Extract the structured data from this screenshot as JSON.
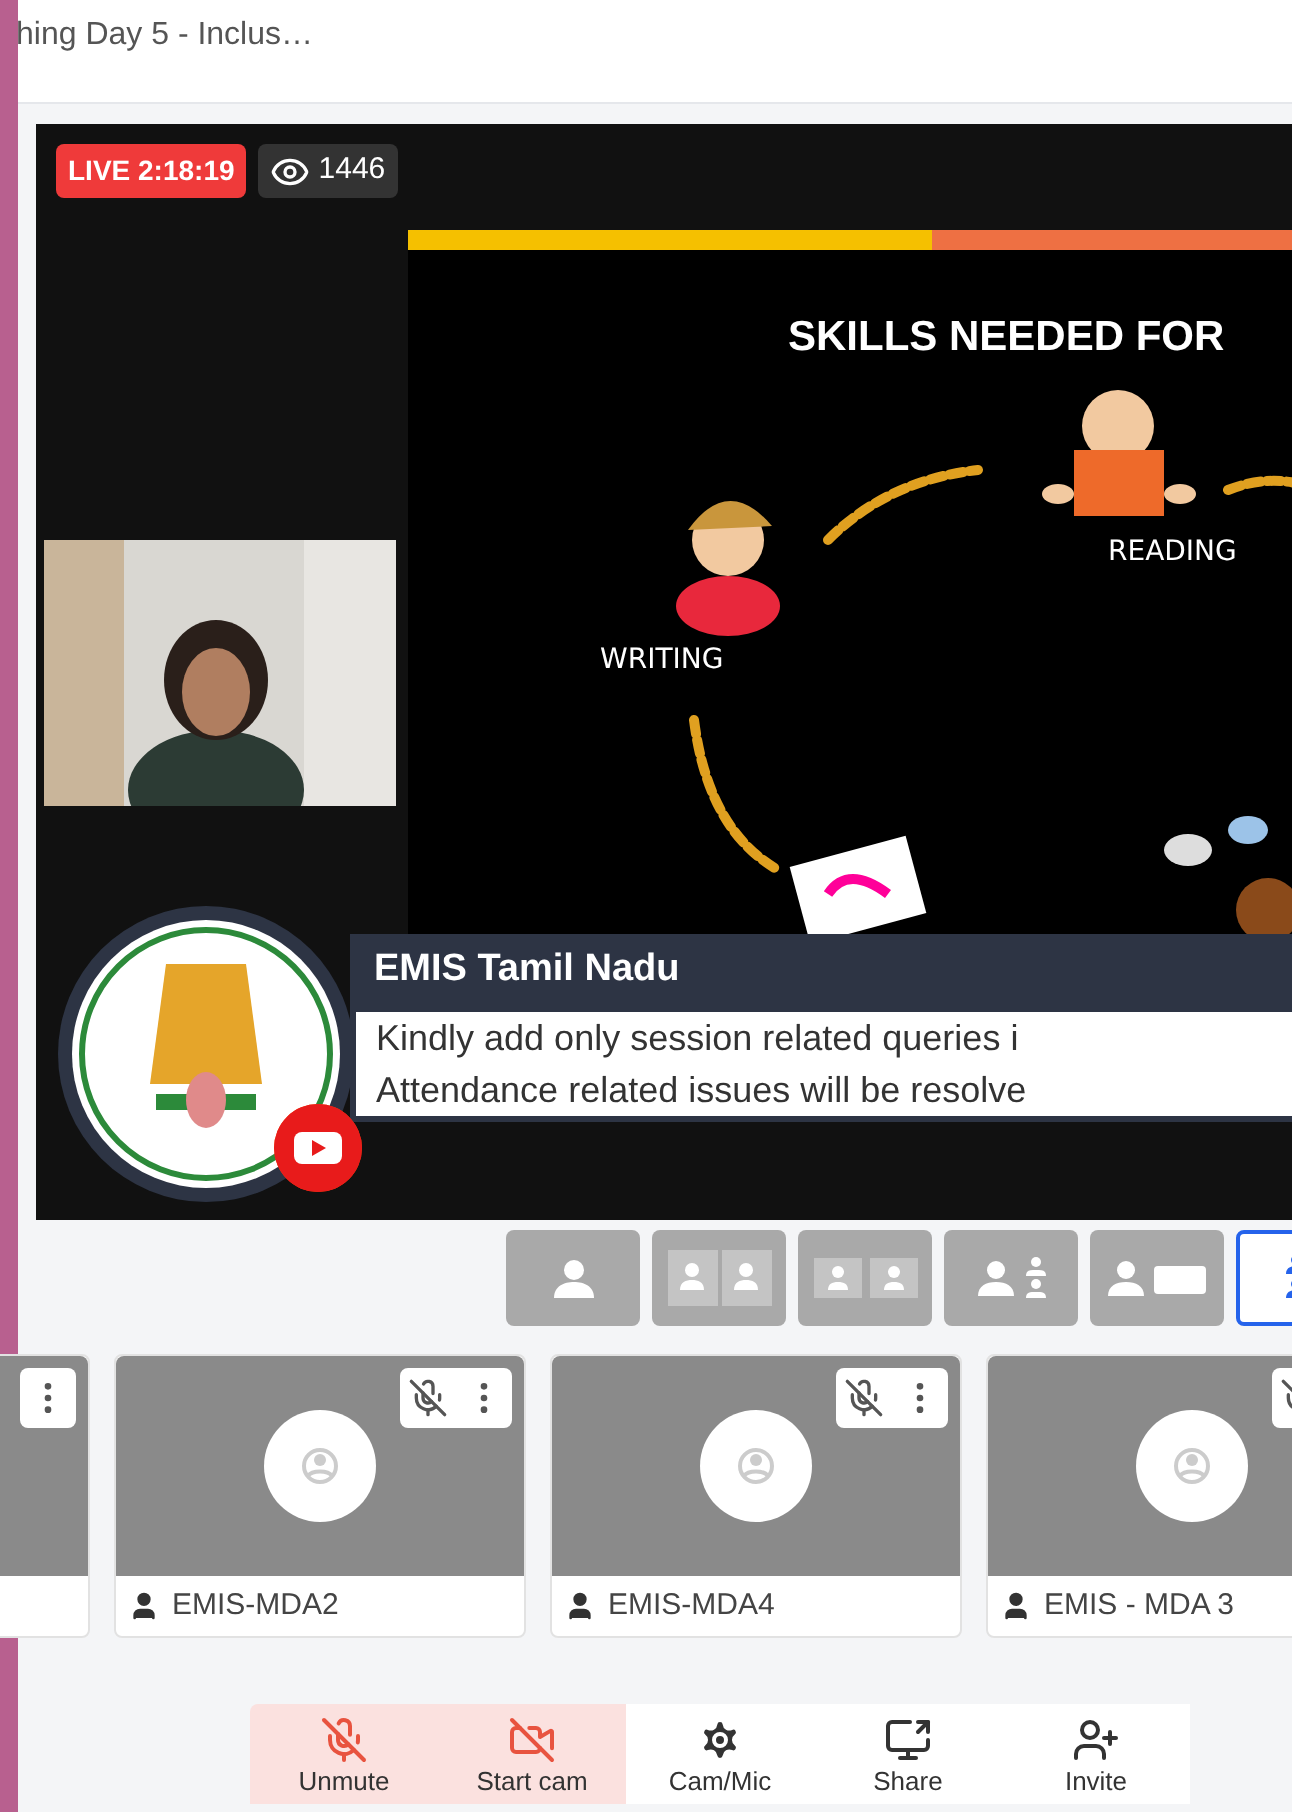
{
  "window": {
    "title": "hing Day 5 - Inclus…"
  },
  "stream": {
    "live_label": "LIVE 2:18:19",
    "viewers": "1446"
  },
  "slide": {
    "title": "SKILLS NEEDED FOR",
    "labels": [
      "WRITING",
      "READING"
    ]
  },
  "banner": {
    "title": "EMIS Tamil Nadu",
    "lines": [
      "Kindly add only session related queries i",
      "Attendance related issues will be resolve"
    ]
  },
  "layouts": [
    {
      "kind": "single",
      "selected": false
    },
    {
      "kind": "split",
      "selected": false
    },
    {
      "kind": "tiles",
      "selected": false
    },
    {
      "kind": "stack",
      "selected": false
    },
    {
      "kind": "speaker",
      "selected": false
    },
    {
      "kind": "sidebar",
      "selected": true
    }
  ],
  "participants": [
    {
      "kind": "cut_left",
      "muted": false
    },
    {
      "kind": "full",
      "name": "EMIS-MDA2",
      "muted": true
    },
    {
      "kind": "full",
      "name": "EMIS-MDA4",
      "muted": true
    },
    {
      "kind": "cut_right",
      "name": "EMIS - MDA 3",
      "muted": true
    }
  ],
  "toolbar": [
    {
      "kind": "mic",
      "label": "Unmute",
      "off": true
    },
    {
      "kind": "cam",
      "label": "Start cam",
      "off": true
    },
    {
      "kind": "settings",
      "label": "Cam/Mic",
      "off": false
    },
    {
      "kind": "share",
      "label": "Share",
      "off": false
    },
    {
      "kind": "invite",
      "label": "Invite",
      "off": false
    }
  ]
}
